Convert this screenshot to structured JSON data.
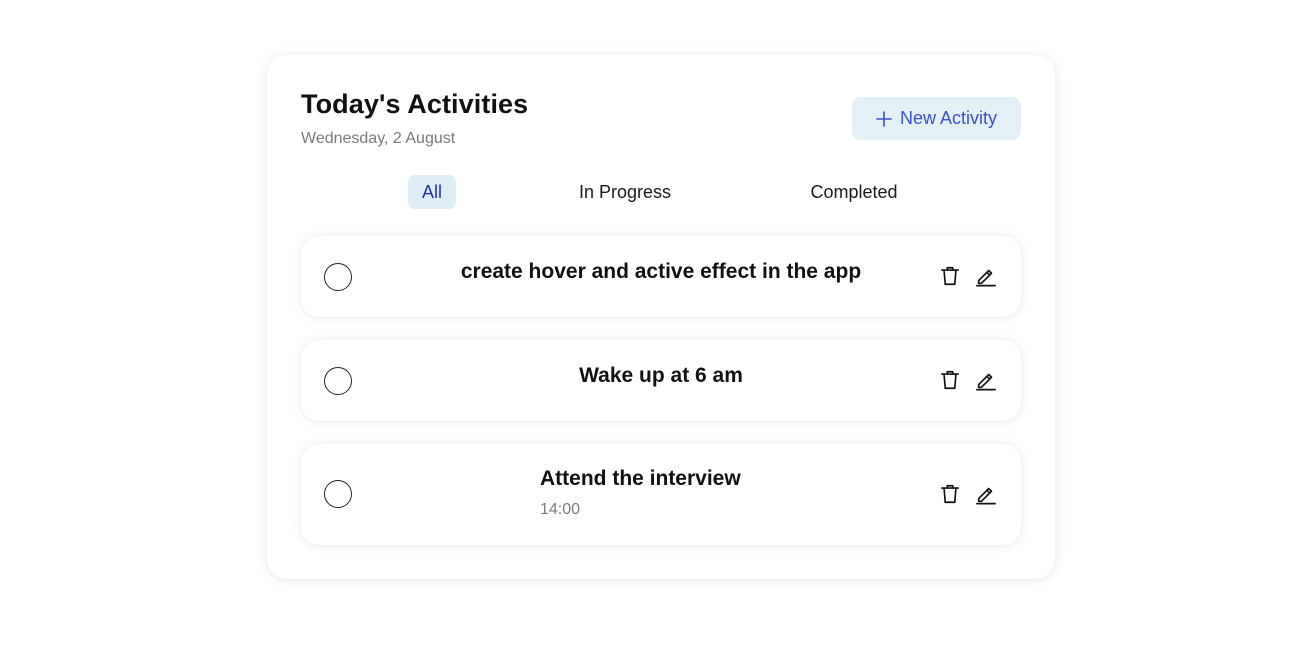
{
  "header": {
    "title": "Today's Activities",
    "date": "Wednesday, 2 August",
    "new_button_label": "New Activity",
    "new_button_icon": "plus-icon"
  },
  "tabs": [
    {
      "label": "All",
      "active": true
    },
    {
      "label": "In Progress",
      "active": false
    },
    {
      "label": "Completed",
      "active": false
    }
  ],
  "activities": [
    {
      "title": "create hover and active effect in the app",
      "time": "",
      "completed": false
    },
    {
      "title": "Wake up at 6 am",
      "time": "",
      "completed": false
    },
    {
      "title": "Attend the interview",
      "time": "14:00",
      "completed": false
    }
  ],
  "icons": {
    "delete": "trash-icon",
    "edit": "pencil-icon"
  },
  "colors": {
    "accent": "#3b4fcf",
    "accent_bg": "#e3f0f6",
    "active_tab_bg": "#dfeef6",
    "active_tab_text": "#2233aa",
    "muted_text": "#7a7a7a"
  }
}
